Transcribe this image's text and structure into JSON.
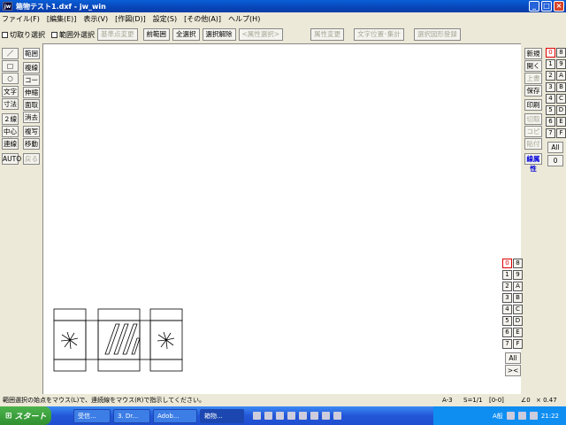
{
  "window": {
    "title": "箱物テスト1.dxf - jw_win",
    "app_icon": "jw"
  },
  "menu": [
    "ファイル(F)",
    "[編集(E)]",
    "表示(V)",
    "[作図(D)]",
    "設定(S)",
    "[その他(A)]",
    "ヘルプ(H)"
  ],
  "toolbar": {
    "check1": "切取り選択",
    "check2": "範囲外選択",
    "btn_base": "基準点変更",
    "btn_prev": "前範囲",
    "btn_all": "全選択",
    "btn_release": "選択解除",
    "btn_attr": "<属性選択>",
    "btn_attrchange": "属性変更",
    "btn_textpos": "文字位置･集計",
    "btn_register": "選択図形登録"
  },
  "left_tools": {
    "col1": [
      "／",
      "□",
      "○",
      "文字",
      "寸法",
      "２線",
      "中心線",
      "連線",
      "AUTO"
    ],
    "col2": [
      "範囲",
      "複線",
      "コーナー",
      "伸縮",
      "面取",
      "消去",
      "複写",
      "移動",
      "戻る"
    ]
  },
  "right_tools": [
    "新規",
    "開く",
    "上書",
    "保存",
    "印刷",
    "切取",
    "コピー",
    "貼付",
    "線属性"
  ],
  "layer_groups": [
    "0",
    "8",
    "1",
    "9",
    "2",
    "A",
    "3",
    "B",
    "4",
    "C",
    "5",
    "D",
    "6",
    "E",
    "7",
    "F"
  ],
  "layer_all": "All",
  "layer_zero": "0",
  "layers": [
    "0",
    "8",
    "1",
    "9",
    "2",
    "A",
    "3",
    "B",
    "4",
    "C",
    "5",
    "D",
    "6",
    "E",
    "7",
    "F"
  ],
  "layers_all": "All",
  "layers_x": "><",
  "status": {
    "message": "範囲選択の始点をマウス(L)で、連続線をマウス(R)で指示してください。",
    "paper": "A-3",
    "scale": "S=1/1",
    "layer": "[0-0]",
    "angle": "∠0",
    "zoom": "× 0.47"
  },
  "taskbar": {
    "start": "スタート",
    "tasks": [
      "受信...",
      "3. Dr...",
      "Adob...",
      "箱物..."
    ],
    "clock": "21:22",
    "ime": "A般"
  }
}
